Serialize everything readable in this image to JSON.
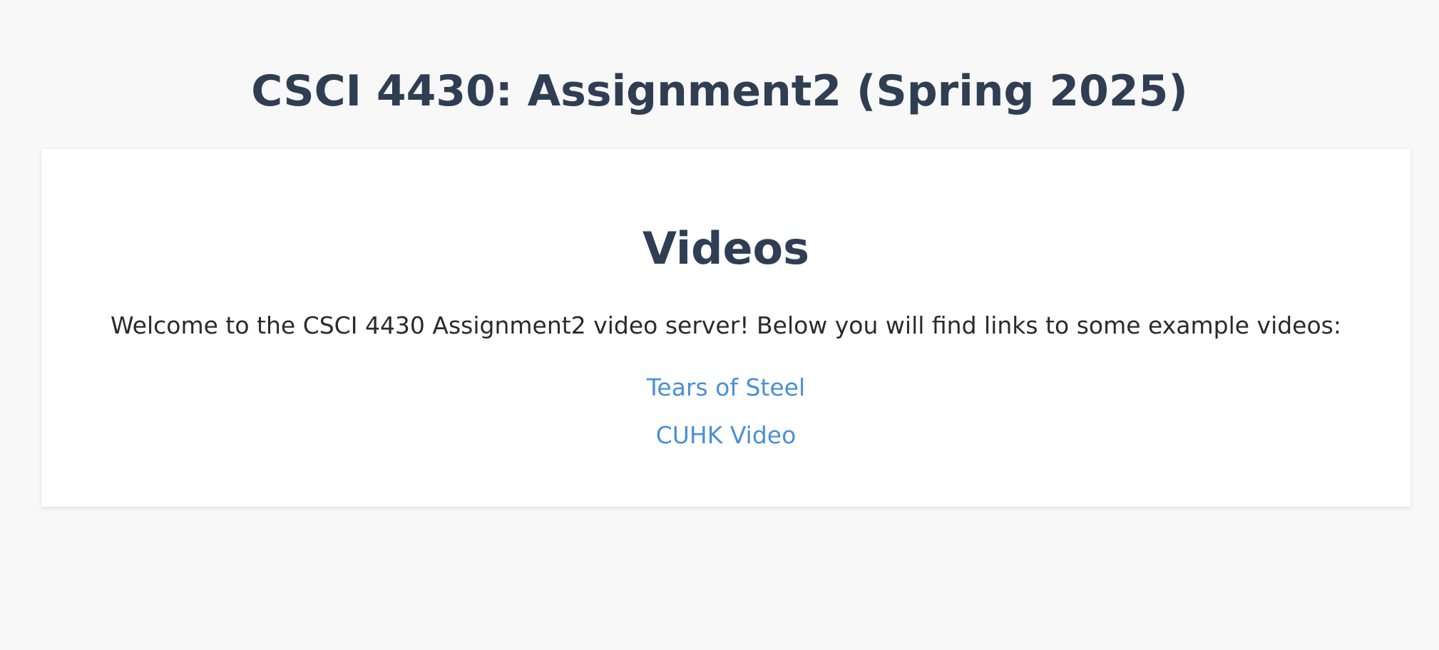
{
  "header": {
    "title": "CSCI 4430: Assignment2 (Spring 2025)"
  },
  "main": {
    "heading": "Videos",
    "intro": "Welcome to the CSCI 4430 Assignment2 video server! Below you will find links to some example videos:",
    "links": [
      {
        "label": "Tears of Steel"
      },
      {
        "label": "CUHK Video"
      }
    ]
  },
  "colors": {
    "background": "#f8f8f8",
    "card": "#ffffff",
    "heading": "#2f3e52",
    "body_text": "#2a2a2a",
    "link": "#4a90d6"
  }
}
